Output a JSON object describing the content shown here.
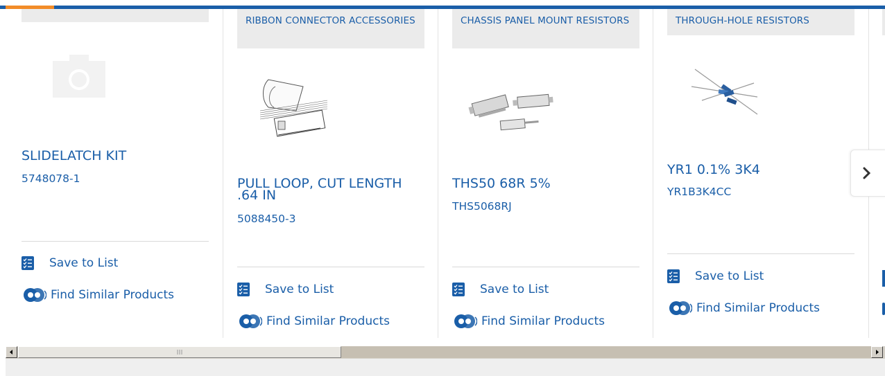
{
  "colors": {
    "brand_blue": "#1a5ea8",
    "accent_orange": "#f28c28",
    "category_bg": "#ebebeb"
  },
  "actions": {
    "save_label": "Save to List",
    "similar_label": "Find Similar Products"
  },
  "products": [
    {
      "category": "",
      "title": "SLIDELATCH KIT",
      "part": "5748078-1",
      "image": "placeholder-camera-icon"
    },
    {
      "category": "RIBBON CONNECTOR ACCESSORIES",
      "title": "PULL LOOP, CUT LENGTH .64 IN",
      "part": "5088450-3",
      "image": "ribbon-connector-image"
    },
    {
      "category": "CHASSIS PANEL MOUNT RESISTORS",
      "title": "THS50 68R 5%",
      "part": "THS5068RJ",
      "image": "chassis-resistor-image"
    },
    {
      "category": "THROUGH-HOLE RESISTORS",
      "title": "YR1 0.1% 3K4",
      "part": "YR1B3K4CC",
      "image": "through-hole-resistor-image"
    }
  ],
  "icons": {
    "next": "chevron-right-icon",
    "save": "checklist-icon",
    "similar": "gears-icon"
  }
}
